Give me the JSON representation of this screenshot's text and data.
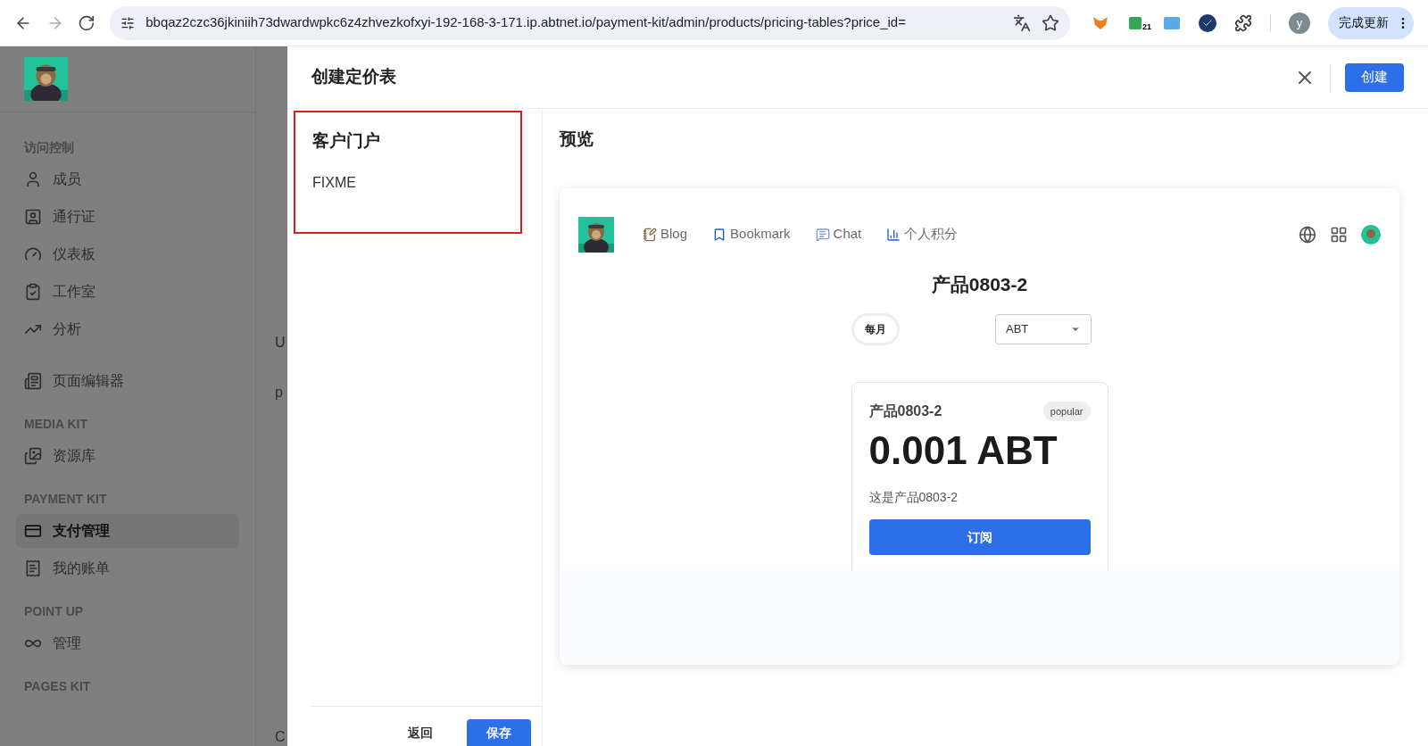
{
  "browser": {
    "url": "bbqaz2czc36jkiniih73dwardwpkc6z4zhvezkofxyi-192-168-3-171.ip.abtnet.io/payment-kit/admin/products/pricing-tables?price_id=",
    "extension_badge": "21",
    "profile_initial": "y",
    "update_button": "完成更新"
  },
  "sidebar": {
    "sections": [
      {
        "heading": "访问控制",
        "items": [
          {
            "label": "成员",
            "selected": false
          },
          {
            "label": "通行证",
            "selected": false
          },
          {
            "label": "仪表板",
            "selected": false
          },
          {
            "label": "工作室",
            "selected": false
          },
          {
            "label": "分析",
            "selected": false
          }
        ]
      },
      {
        "items": [
          {
            "label": "页面编辑器",
            "selected": false
          }
        ]
      },
      {
        "heading": "MEDIA KIT",
        "items": [
          {
            "label": "资源库",
            "selected": false
          }
        ]
      },
      {
        "heading": "PAYMENT KIT",
        "items": [
          {
            "label": "支付管理",
            "selected": true
          },
          {
            "label": "我的账单",
            "selected": false
          }
        ]
      },
      {
        "heading": "POINT UP",
        "items": [
          {
            "label": "管理",
            "selected": false
          }
        ]
      },
      {
        "heading": "PAGES KIT"
      }
    ]
  },
  "background_fragments": [
    "U",
    "p",
    "C"
  ],
  "drawer": {
    "title": "创建定价表",
    "create_button": "创建",
    "portal": {
      "title": "客户门户",
      "text": "FIXME",
      "highlighted": true
    },
    "footer": {
      "back_button": "返回",
      "save_button": "保存"
    },
    "preview": {
      "title": "预览",
      "nav": [
        {
          "label": "Blog"
        },
        {
          "label": "Bookmark"
        },
        {
          "label": "Chat"
        },
        {
          "label": "个人积分"
        }
      ],
      "product_title": "产品0803-2",
      "interval": "每月",
      "currency": "ABT",
      "card": {
        "name": "产品0803-2",
        "badge": "popular",
        "price": "0.001 ABT",
        "description": "这是产品0803-2",
        "button": "订阅"
      }
    }
  }
}
